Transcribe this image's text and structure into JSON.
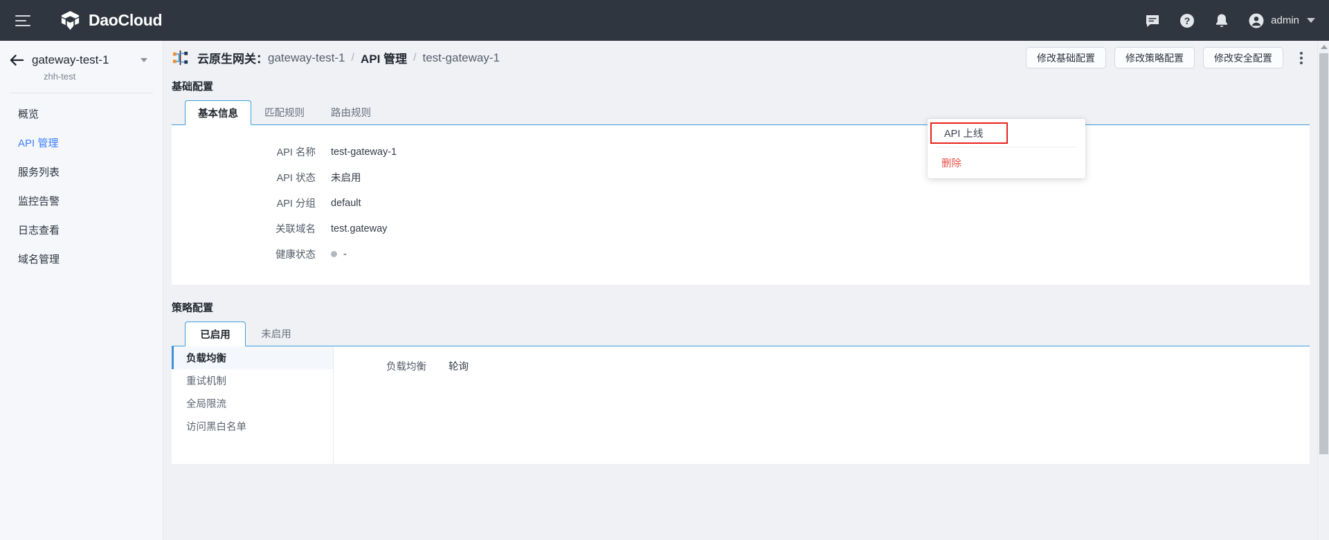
{
  "topbar": {
    "brand": "DaoCloud",
    "menu_icon": "hamburger-icon",
    "icons": [
      "message-icon",
      "help-icon",
      "bell-icon"
    ],
    "user": "admin"
  },
  "sidebar": {
    "project": "gateway-test-1",
    "namespace": "zhh-test",
    "items": [
      {
        "label": "概览",
        "active": false
      },
      {
        "label": "API 管理",
        "active": true
      },
      {
        "label": "服务列表",
        "active": false
      },
      {
        "label": "监控告警",
        "active": false
      },
      {
        "label": "日志查看",
        "active": false
      },
      {
        "label": "域名管理",
        "active": false
      }
    ]
  },
  "header": {
    "icon": "gateway-topology-icon",
    "crumb_label": "云原生网关：",
    "crumb_gateway": "gateway-test-1",
    "sep": "/",
    "crumb_section": "API 管理",
    "crumb_current": "test-gateway-1",
    "buttons": [
      "修改基础配置",
      "修改策略配置",
      "修改安全配置"
    ],
    "more_menu_icon": "kebab-menu-icon"
  },
  "dropdown": {
    "items": [
      {
        "label": "API 上线",
        "danger": false,
        "highlighted": true
      },
      {
        "label": "删除",
        "danger": true,
        "highlighted": false
      }
    ]
  },
  "basic_section": {
    "title": "基础配置",
    "tabs": [
      {
        "label": "基本信息",
        "active": true
      },
      {
        "label": "匹配规则",
        "active": false
      },
      {
        "label": "路由规则",
        "active": false
      }
    ],
    "fields": [
      {
        "key": "API 名称",
        "value": "test-gateway-1",
        "status_dot": false
      },
      {
        "key": "API 状态",
        "value": "未启用",
        "status_dot": false
      },
      {
        "key": "API 分组",
        "value": "default",
        "status_dot": false
      },
      {
        "key": "关联域名",
        "value": "test.gateway",
        "status_dot": false
      },
      {
        "key": "健康状态",
        "value": "-",
        "status_dot": true
      }
    ]
  },
  "policy_section": {
    "title": "策略配置",
    "tabs": [
      {
        "label": "已启用",
        "active": true
      },
      {
        "label": "未启用",
        "active": false
      }
    ],
    "list": [
      {
        "label": "负载均衡",
        "active": true
      },
      {
        "label": "重试机制",
        "active": false
      },
      {
        "label": "全局限流",
        "active": false
      },
      {
        "label": "访问黑白名单",
        "active": false
      }
    ],
    "detail": {
      "key": "负载均衡",
      "value": "轮询"
    }
  },
  "colors": {
    "topbar_bg": "#303640",
    "accent": "#3d7eff",
    "tab_border": "#3b9bdc",
    "danger": "#e8504a",
    "highlight_box": "#e8201a"
  }
}
